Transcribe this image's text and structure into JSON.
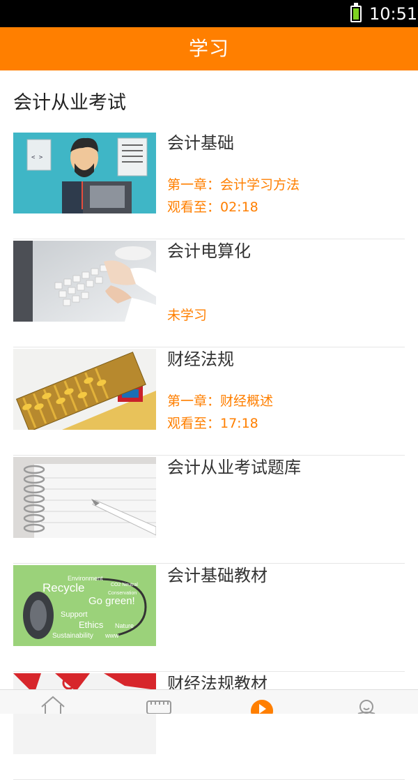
{
  "status_bar": {
    "time": "10:51",
    "battery_icon": "battery-icon"
  },
  "header": {
    "title": "学习"
  },
  "section": {
    "title": "会计从业考试"
  },
  "courses": [
    {
      "title": "会计基础",
      "sub1": "第一章：会计学习方法",
      "sub2": "观看至：02:18",
      "thumb": "teacher-illustration"
    },
    {
      "title": "会计电算化",
      "sub1": "",
      "sub2": "未学习",
      "thumb": "keyboard-photo"
    },
    {
      "title": "财经法规",
      "sub1": "第一章：财经概述",
      "sub2": "观看至：17:18",
      "thumb": "abacus-bankcard-photo"
    },
    {
      "title": "会计从业考试题库",
      "sub1": "",
      "sub2": "",
      "thumb": "notebook-pen-photo"
    },
    {
      "title": "会计基础教材",
      "sub1": "",
      "sub2": "",
      "thumb": "recycle-green-mouse-photo",
      "thumb_words": [
        "Environment",
        "CO2 Neutral",
        "Recycle",
        "Conservation",
        "Go green!",
        "Support",
        "Ethics",
        "Nature",
        "Sustainability",
        "www"
      ]
    },
    {
      "title": "财经法规教材",
      "sub1": "",
      "sub2": "",
      "thumb": "red-pattern-photo"
    }
  ],
  "tabbar": {
    "tabs": [
      {
        "icon": "home-icon",
        "active": false
      },
      {
        "icon": "keyboard-icon",
        "active": false
      },
      {
        "icon": "play-icon",
        "active": true
      },
      {
        "icon": "user-icon",
        "active": false
      }
    ]
  },
  "colors": {
    "accent": "#ff7f00",
    "status_bar": "#000000",
    "divider": "#e6e6e6"
  }
}
